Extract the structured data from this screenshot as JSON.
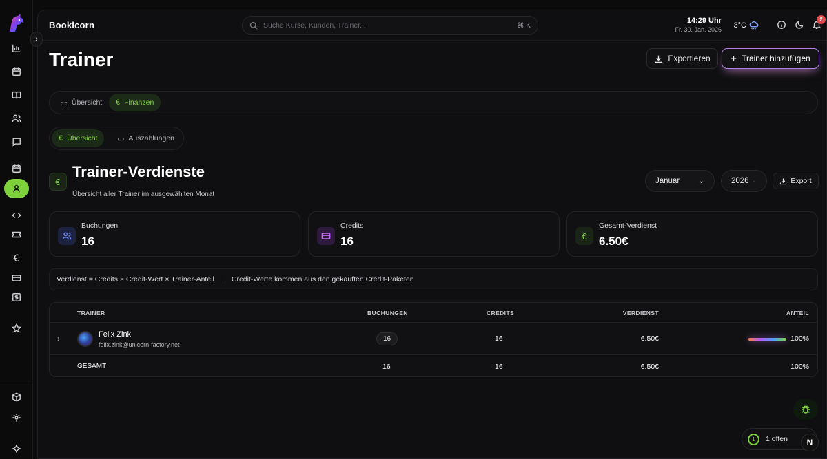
{
  "header": {
    "brand": "Bookicorn",
    "search_placeholder": "Suche Kurse, Kunden, Trainer...",
    "search_shortcut": "⌘ K",
    "time": "14:29 Uhr",
    "date": "Fr. 30. Jan. 2026",
    "temperature": "3°C",
    "weather_icon": "cloud-rain-icon",
    "notification_count": "2"
  },
  "sidebar": {
    "items": [
      {
        "name": "chart-icon"
      },
      {
        "name": "calendar-icon"
      },
      {
        "name": "book-icon"
      },
      {
        "name": "users-icon"
      },
      {
        "name": "message-icon"
      },
      {
        "name": "calendar-2-icon"
      },
      {
        "name": "user-icon",
        "active": true
      },
      {
        "name": "code-icon"
      },
      {
        "name": "ticket-icon"
      },
      {
        "name": "euro-icon"
      },
      {
        "name": "card-icon"
      },
      {
        "name": "dollar-icon"
      },
      {
        "name": "star-icon"
      }
    ],
    "bottom": [
      {
        "name": "box-icon"
      },
      {
        "name": "settings-icon"
      },
      {
        "name": "sparkle-icon"
      }
    ]
  },
  "page": {
    "title": "Trainer",
    "export_label": "Exportieren",
    "add_label": "Trainer hinzufügen"
  },
  "tabs": {
    "main": [
      {
        "label": "Übersicht",
        "icon": "list-icon"
      },
      {
        "label": "Finanzen",
        "icon": "euro-icon",
        "active": true
      }
    ],
    "sub": [
      {
        "label": "Übersicht",
        "icon": "euro-icon",
        "active": true
      },
      {
        "label": "Auszahlungen",
        "icon": "cash-icon"
      }
    ]
  },
  "section": {
    "title": "Trainer-Verdienste",
    "subtitle": "Übersicht aller Trainer im ausgewählten Monat",
    "month": "Januar",
    "year": "2026",
    "export_label": "Export"
  },
  "stats": [
    {
      "label": "Buchungen",
      "value": "16",
      "icon": "users-icon",
      "color": "#6f8cff"
    },
    {
      "label": "Credits",
      "value": "16",
      "icon": "card-icon",
      "color": "#c46bff"
    },
    {
      "label": "Gesamt-Verdienst",
      "value": "6.50€",
      "icon": "euro-icon",
      "color": "#7fd13b"
    }
  ],
  "info": {
    "formula": "Verdienst = Credits × Credit-Wert × Trainer-Anteil",
    "note": "Credit-Werte kommen aus den gekauften Credit-Paketen"
  },
  "table": {
    "headers": [
      "TRAINER",
      "BUCHUNGEN",
      "CREDITS",
      "VERDIENST",
      "ANTEIL"
    ],
    "rows": [
      {
        "name": "Felix Zink",
        "email": "felix.zink@unicorn-factory.net",
        "bookings": "16",
        "credits": "16",
        "earnings": "6.50€",
        "share": "100%",
        "share_fraction": 1.0
      }
    ],
    "total": {
      "label": "GESAMT",
      "bookings": "16",
      "credits": "16",
      "earnings": "6.50€",
      "share": "100%"
    }
  },
  "floating": {
    "open_count": "1",
    "open_label": "1 offen",
    "n_badge": "N"
  },
  "colors": {
    "accent": "#7fd13b",
    "background": "#0b0b0c",
    "notification": "#e5484d"
  }
}
